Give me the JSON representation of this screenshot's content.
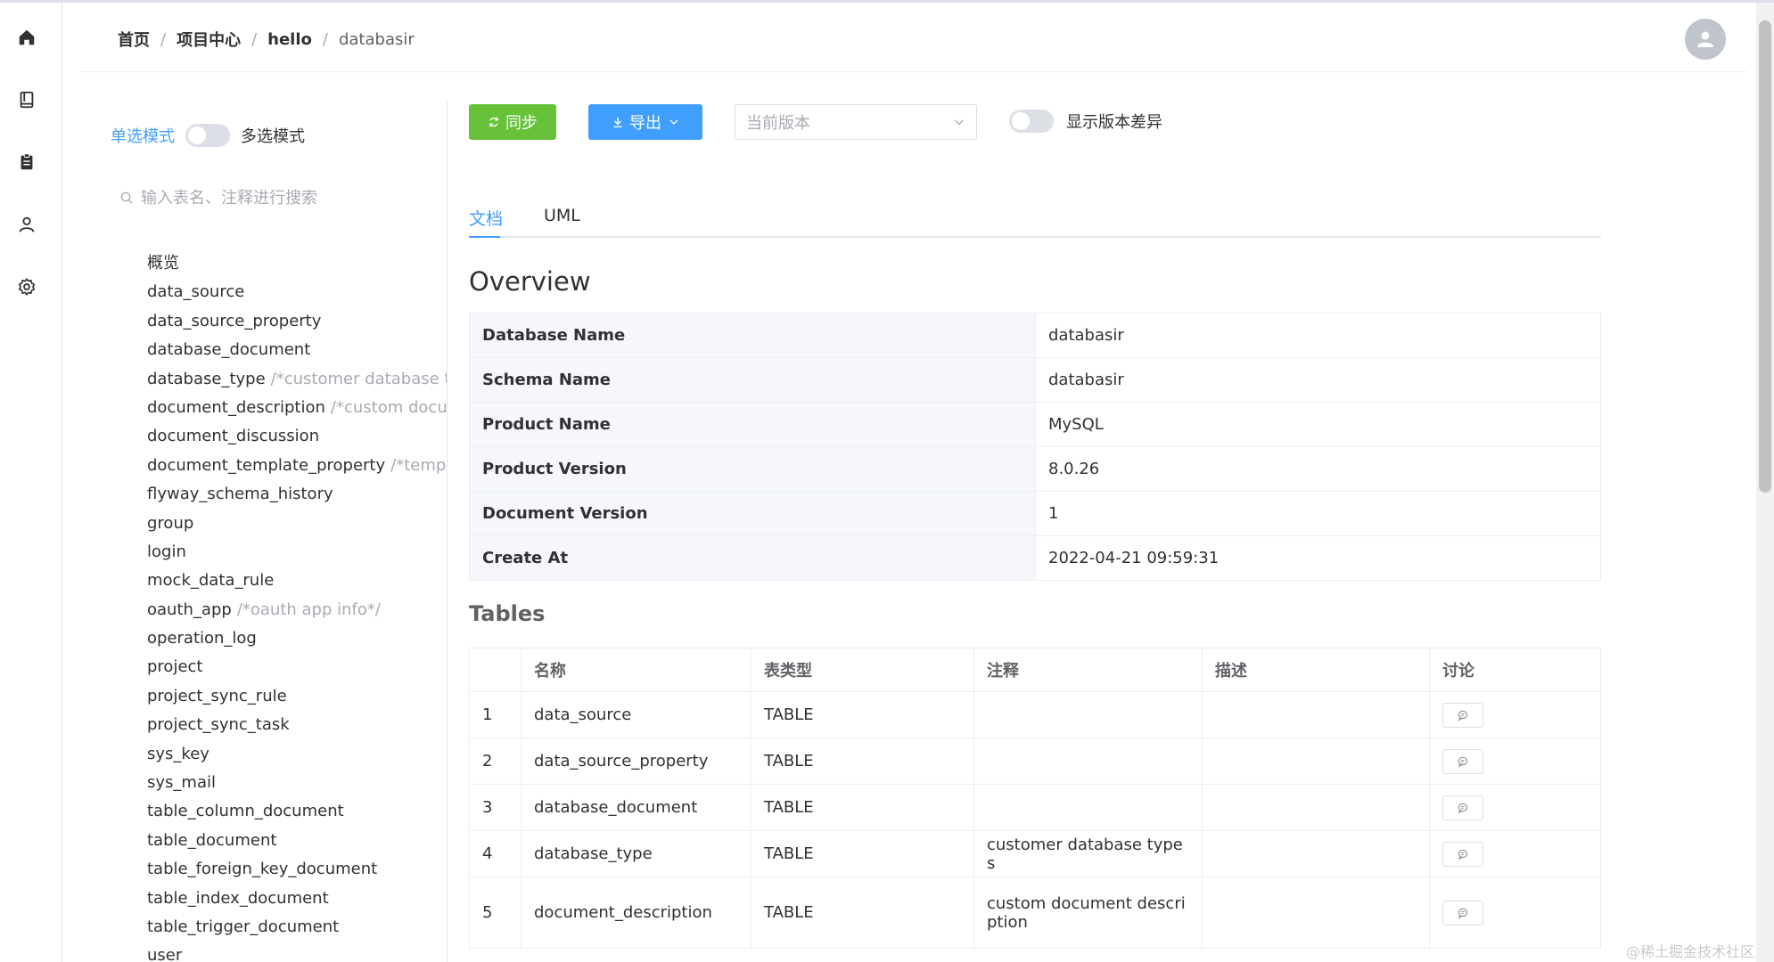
{
  "nav": {
    "icons": [
      "home-icon",
      "book-icon",
      "clipboard-icon",
      "user-icon",
      "gear-icon"
    ]
  },
  "header": {
    "breadcrumbs": [
      "首页",
      "项目中心",
      "hello",
      "databasir"
    ]
  },
  "sidebar": {
    "mode_single": "单选模式",
    "mode_multi": "多选模式",
    "search_placeholder": "输入表名、注释进行搜索",
    "items": [
      {
        "name": "概览",
        "comment": ""
      },
      {
        "name": "data_source",
        "comment": ""
      },
      {
        "name": "data_source_property",
        "comment": ""
      },
      {
        "name": "database_document",
        "comment": ""
      },
      {
        "name": "database_type",
        "comment": "/*customer database type"
      },
      {
        "name": "document_description",
        "comment": "/*custom docume"
      },
      {
        "name": "document_discussion",
        "comment": ""
      },
      {
        "name": "document_template_property",
        "comment": "/*templat"
      },
      {
        "name": "flyway_schema_history",
        "comment": ""
      },
      {
        "name": "group",
        "comment": ""
      },
      {
        "name": "login",
        "comment": ""
      },
      {
        "name": "mock_data_rule",
        "comment": ""
      },
      {
        "name": "oauth_app",
        "comment": "/*oauth app info*/"
      },
      {
        "name": "operation_log",
        "comment": ""
      },
      {
        "name": "project",
        "comment": ""
      },
      {
        "name": "project_sync_rule",
        "comment": ""
      },
      {
        "name": "project_sync_task",
        "comment": ""
      },
      {
        "name": "sys_key",
        "comment": ""
      },
      {
        "name": "sys_mail",
        "comment": ""
      },
      {
        "name": "table_column_document",
        "comment": ""
      },
      {
        "name": "table_document",
        "comment": ""
      },
      {
        "name": "table_foreign_key_document",
        "comment": ""
      },
      {
        "name": "table_index_document",
        "comment": ""
      },
      {
        "name": "table_trigger_document",
        "comment": ""
      },
      {
        "name": "user",
        "comment": ""
      }
    ]
  },
  "toolbar": {
    "sync_label": "同步",
    "export_label": "导出",
    "version_placeholder": "当前版本",
    "diff_label": "显示版本差异"
  },
  "tabs": {
    "doc": "文档",
    "uml": "UML"
  },
  "overview": {
    "title": "Overview",
    "rows": [
      {
        "key": "Database Name",
        "value": "databasir"
      },
      {
        "key": "Schema Name",
        "value": "databasir"
      },
      {
        "key": "Product Name",
        "value": "MySQL"
      },
      {
        "key": "Product Version",
        "value": "8.0.26"
      },
      {
        "key": "Document Version",
        "value": "1"
      },
      {
        "key": "Create At",
        "value": "2022-04-21 09:59:31"
      }
    ]
  },
  "tables": {
    "title": "Tables",
    "headers": [
      "",
      "名称",
      "表类型",
      "注释",
      "描述",
      "讨论"
    ],
    "rows": [
      {
        "idx": "1",
        "name": "data_source",
        "type": "TABLE",
        "comment": "",
        "desc": ""
      },
      {
        "idx": "2",
        "name": "data_source_property",
        "type": "TABLE",
        "comment": "",
        "desc": ""
      },
      {
        "idx": "3",
        "name": "database_document",
        "type": "TABLE",
        "comment": "",
        "desc": ""
      },
      {
        "idx": "4",
        "name": "database_type",
        "type": "TABLE",
        "comment": "customer database types",
        "desc": ""
      },
      {
        "idx": "5",
        "name": "document_description",
        "type": "TABLE",
        "comment": "custom document description",
        "desc": ""
      }
    ]
  },
  "watermark": "@稀土掘金技术社区",
  "colors": {
    "primary": "#409eff",
    "success": "#67c23a",
    "border": "#ebeef5",
    "muted": "#a8abb2"
  }
}
